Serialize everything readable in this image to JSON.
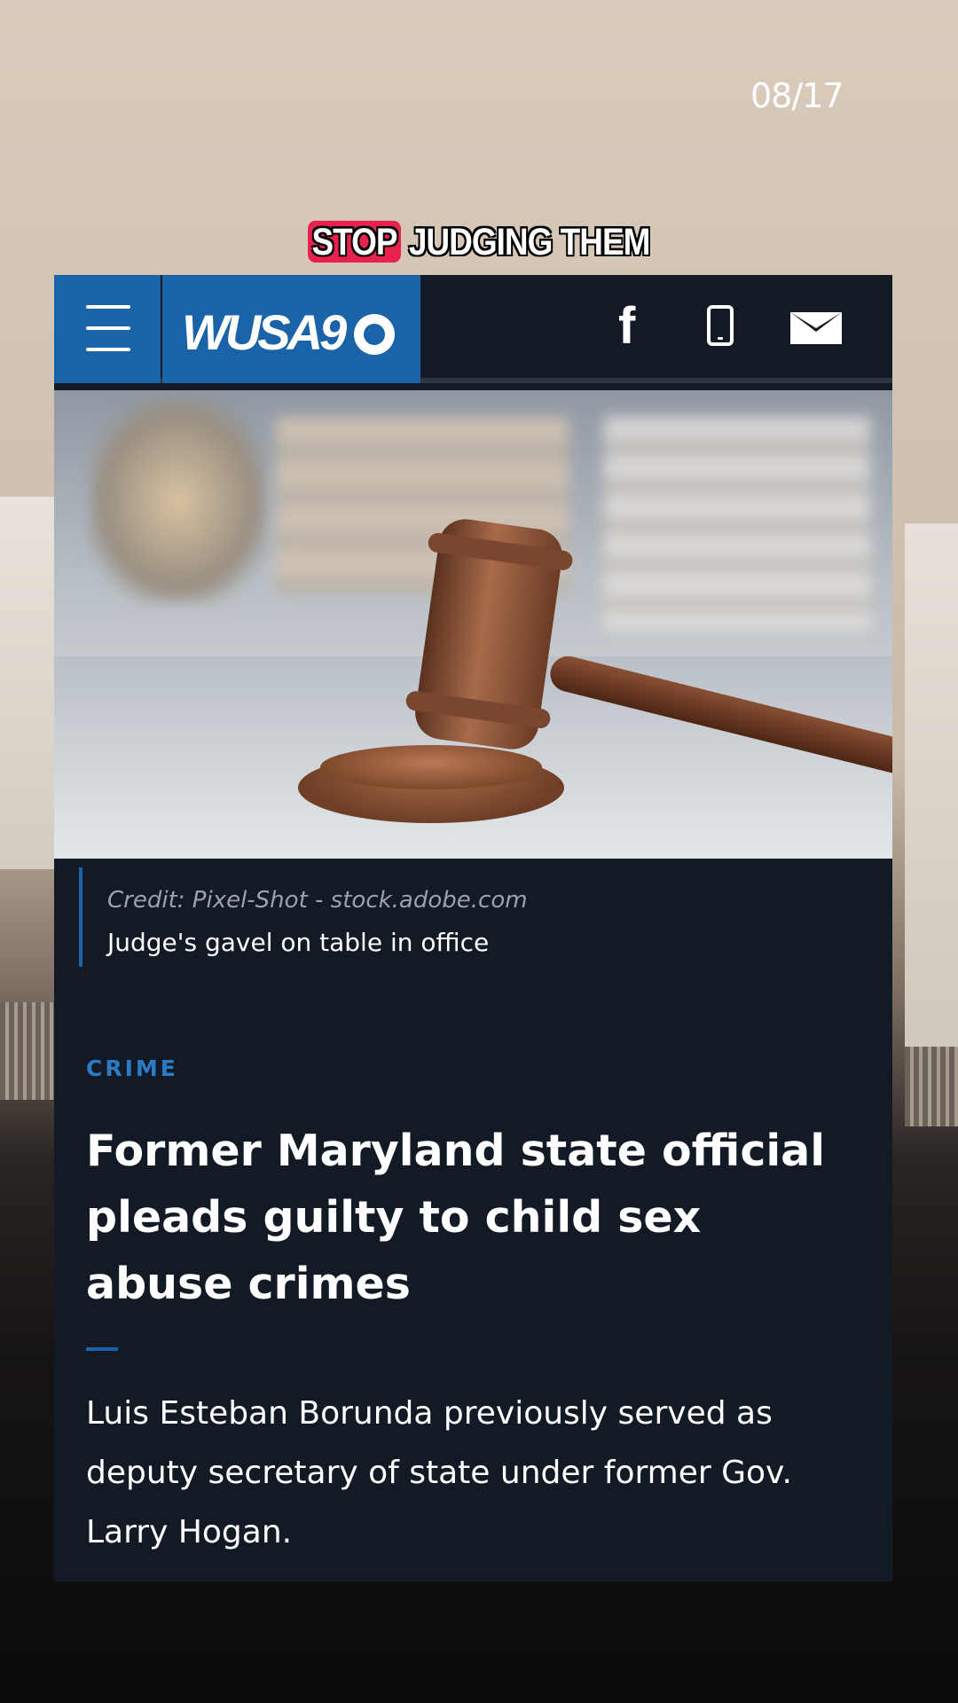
{
  "overlay": {
    "counter": "08/17",
    "caption_highlight": "STOP",
    "caption_rest": "JUDGING THEM"
  },
  "nav": {
    "logo_text": "WUSA9",
    "icons": [
      "menu-icon",
      "facebook-icon",
      "phone-icon",
      "mail-icon"
    ],
    "facebook_glyph": "f"
  },
  "article": {
    "image_credit": "Credit: Pixel-Shot - stock.adobe.com",
    "image_caption": "Judge's gavel on table in office",
    "section": "CRIME",
    "headline": "Former Maryland state official pleads guilty to child sex abuse crimes",
    "summary": "Luis Esteban Borunda previously served as deputy secretary of state under former Gov. Larry Hogan."
  },
  "colors": {
    "brand_blue": "#1a63a8",
    "card_bg": "#111a25",
    "caption_highlight": "#e8224e",
    "section_label": "#2c7bc7"
  }
}
